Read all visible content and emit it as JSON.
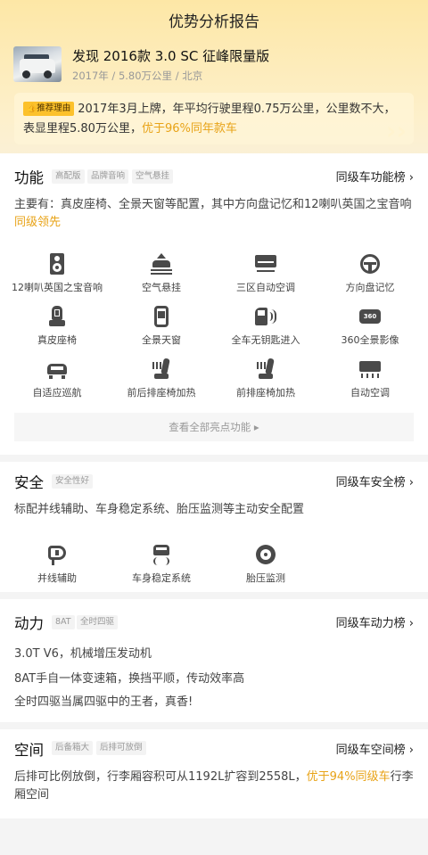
{
  "page": {
    "title": "优势分析报告"
  },
  "car": {
    "name": "发现 2016款 3.0 SC 征峰限量版",
    "meta": "2017年 / 5.80万公里 / 北京"
  },
  "reason": {
    "tag": "推荐理由",
    "text": "2017年3月上牌，年平均行驶里程0.75万公里，公里数不大，表显里程5.80万公里，",
    "highlight": "优于96%同年款车"
  },
  "function": {
    "title": "功能",
    "tags": [
      "高配版",
      "品牌音响",
      "空气悬挂"
    ],
    "rank": "同级车功能榜 ›",
    "desc": "主要有：真皮座椅、全景天窗等配置，其中方向盘记忆和12喇叭英国之宝音响",
    "desc_hl": "同级领先",
    "features": [
      {
        "label": "12喇叭英国之宝音响",
        "icon": "speaker-icon"
      },
      {
        "label": "空气悬挂",
        "icon": "air-suspension-icon"
      },
      {
        "label": "三区自动空调",
        "icon": "air-conditioner-icon"
      },
      {
        "label": "方向盘记忆",
        "icon": "steering-wheel-icon"
      },
      {
        "label": "真皮座椅",
        "icon": "leather-seat-icon"
      },
      {
        "label": "全景天窗",
        "icon": "sunroof-icon"
      },
      {
        "label": "全车无钥匙进入",
        "icon": "keyless-entry-icon"
      },
      {
        "label": "360全景影像",
        "icon": "panoramic-camera-icon"
      },
      {
        "label": "自适应巡航",
        "icon": "adaptive-cruise-icon"
      },
      {
        "label": "前后排座椅加热",
        "icon": "seat-heating-icon"
      },
      {
        "label": "前排座椅加热",
        "icon": "front-seat-heating-icon"
      },
      {
        "label": "自动空调",
        "icon": "auto-ac-icon"
      }
    ],
    "see_all": "查看全部亮点功能 ▸"
  },
  "safety": {
    "title": "安全",
    "tag": "安全性好",
    "rank": "同级车安全榜 ›",
    "desc": "标配并线辅助、车身稳定系统、胎压监测等主动安全配置",
    "features": [
      {
        "label": "并线辅助",
        "icon": "lane-assist-icon"
      },
      {
        "label": "车身稳定系统",
        "icon": "stability-control-icon"
      },
      {
        "label": "胎压监测",
        "icon": "tire-pressure-icon"
      }
    ]
  },
  "power": {
    "title": "动力",
    "tags": [
      "8AT",
      "全时四驱"
    ],
    "rank": "同级车动力榜 ›",
    "lines": [
      "3.0T V6，机械增压发动机",
      "8AT手自一体变速箱，换挡平顺，传动效率高",
      "全时四驱当属四驱中的王者，真香!"
    ]
  },
  "space": {
    "title": "空间",
    "tags": [
      "后备箱大",
      "后排可放倒"
    ],
    "rank": "同级车空间榜 ›",
    "desc": "后排可比例放倒，行李厢容积可从1192L扩容到2558L，",
    "desc_hl": "优于94%同级车",
    "desc_end": "行李厢空间"
  },
  "colors": {
    "accent": "#e8a317",
    "tag_bg": "#fcc12b",
    "header": "#fde7a6"
  }
}
